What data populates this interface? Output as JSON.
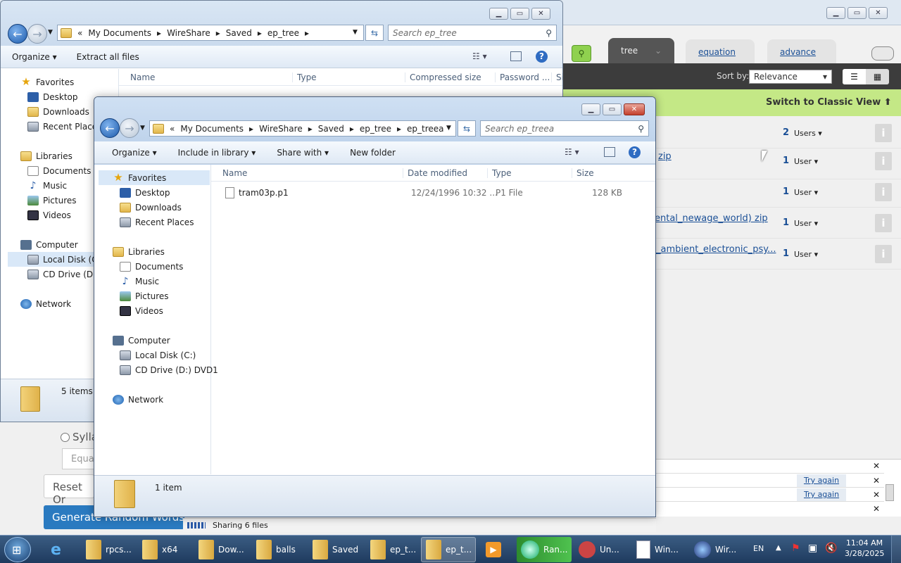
{
  "background_app": {
    "tabs": [
      "tree",
      "equation",
      "advance"
    ],
    "sort_label": "Sort by:",
    "sort_value": "Relevance",
    "classic_view": "Switch to Classic View",
    "rows": [
      {
        "link": "",
        "count": "2",
        "users": "Users"
      },
      {
        "link": "zip",
        "count": "1",
        "users": "User"
      },
      {
        "link": "",
        "count": "1",
        "users": "User"
      },
      {
        "link": "ental_newage_world) zip",
        "count": "1",
        "users": "User"
      },
      {
        "link": "_ambient_electronic_psy...",
        "count": "1",
        "users": "User"
      }
    ],
    "try_again": [
      "Try again",
      "Try again"
    ],
    "left_controls": {
      "radio_label": "Sylla",
      "field_value": "Equa",
      "reset": "Reset Or",
      "generate": "Generate Random Words"
    },
    "sharing": "Sharing 6 files"
  },
  "window_back": {
    "breadcrumb": [
      "My Documents",
      "WireShare",
      "Saved",
      "ep_tree"
    ],
    "search_placeholder": "Search ep_tree",
    "toolbar": {
      "organize": "Organize",
      "extract": "Extract all files"
    },
    "columns": [
      "Name",
      "Type",
      "Compressed size",
      "Password ...",
      "Si"
    ],
    "status": "5 items",
    "nav": {
      "favorites": "Favorites",
      "desktop": "Desktop",
      "downloads": "Downloads",
      "recent": "Recent Places",
      "libraries": "Libraries",
      "documents": "Documents",
      "music": "Music",
      "pictures": "Pictures",
      "videos": "Videos",
      "computer": "Computer",
      "local_disk": "Local Disk (C:)",
      "cd_drive": "CD Drive (D:) DVD1",
      "network": "Network"
    }
  },
  "window_front": {
    "breadcrumb": [
      "My Documents",
      "WireShare",
      "Saved",
      "ep_tree",
      "ep_treea"
    ],
    "search_placeholder": "Search ep_treea",
    "toolbar": {
      "organize": "Organize",
      "include": "Include in library",
      "share": "Share with",
      "new_folder": "New folder"
    },
    "columns": [
      "Name",
      "Date modified",
      "Type",
      "Size"
    ],
    "files": [
      {
        "name": "tram03p.p1",
        "date": "12/24/1996 10:32 ...",
        "type": "P1 File",
        "size": "128 KB"
      }
    ],
    "status": "1 item",
    "nav": {
      "favorites": "Favorites",
      "desktop": "Desktop",
      "downloads": "Downloads",
      "recent": "Recent Places",
      "libraries": "Libraries",
      "documents": "Documents",
      "music": "Music",
      "pictures": "Pictures",
      "videos": "Videos",
      "computer": "Computer",
      "local_disk": "Local Disk (C:)",
      "cd_drive": "CD Drive (D:) DVD1",
      "network": "Network"
    }
  },
  "taskbar": {
    "items": [
      "rpcs...",
      "x64",
      "Dow...",
      "balls",
      "Saved",
      "ep_t...",
      "ep_t...",
      "",
      "Ran...",
      "Un...",
      "Win...",
      "Wir..."
    ],
    "lang": "EN",
    "time": "11:04 AM",
    "date": "3/28/2025"
  },
  "colors": {
    "accent_green": "#c4e886",
    "taskbar": "#1e3a5e",
    "link": "#1a4f96"
  }
}
